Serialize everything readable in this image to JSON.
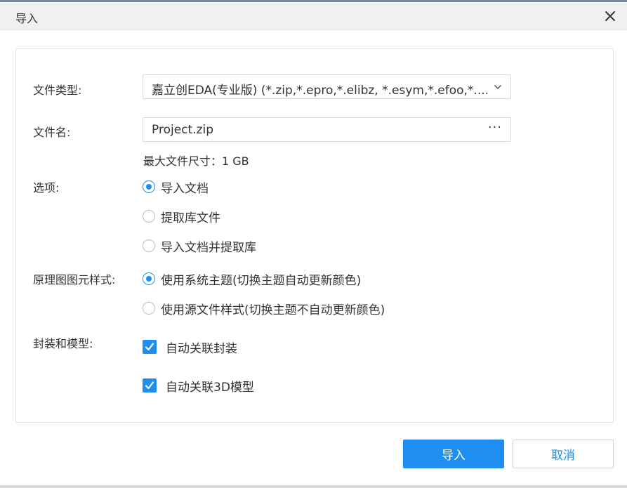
{
  "dialog": {
    "title": "导入",
    "close_icon": "close-icon"
  },
  "form": {
    "file_type": {
      "label": "文件类型:",
      "value": "嘉立创EDA(专业版) (*.zip,*.epro,*.elibz, *.esym,*.efoo,*...."
    },
    "file_name": {
      "label": "文件名:",
      "value": "Project.zip",
      "browse": "···"
    },
    "max_size_hint": "最大文件尺寸：1 GB",
    "options": {
      "label": "选项:",
      "items": [
        {
          "label": "导入文档",
          "selected": true
        },
        {
          "label": "提取库文件",
          "selected": false
        },
        {
          "label": "导入文档并提取库",
          "selected": false
        }
      ]
    },
    "schematic_style": {
      "label": "原理图图元样式:",
      "items": [
        {
          "label": "使用系统主题(切换主题自动更新颜色)",
          "selected": true
        },
        {
          "label": "使用源文件样式(切换主题不自动更新颜色)",
          "selected": false
        }
      ]
    },
    "footprint_model": {
      "label": "封装和模型:",
      "items": [
        {
          "label": "自动关联封装",
          "checked": true
        },
        {
          "label": "自动关联3D模型",
          "checked": true
        }
      ]
    }
  },
  "buttons": {
    "import": "导入",
    "cancel": "取消"
  },
  "colors": {
    "accent": "#1e8ff0",
    "titlebar": "#f0f0f0"
  }
}
